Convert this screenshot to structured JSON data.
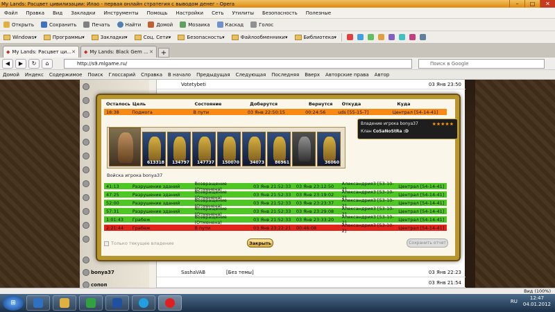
{
  "window": {
    "title": "My Lands: Расцвет цивилизации: Илао - первая онлайн стратегия с выводом денег - Opera"
  },
  "menu": [
    "Файл",
    "Правка",
    "Вид",
    "Закладки",
    "Инструменты",
    "Помощь",
    "Настройки",
    "Сеть",
    "Утилиты",
    "Безопасность",
    "Полезные"
  ],
  "toolbar1": [
    "Открыть",
    "Сохранить",
    "Печать",
    "Найти",
    "Домой",
    "Мозаика",
    "Каскад",
    "Голос"
  ],
  "toolbar2": [
    "Windows",
    "Программы",
    "Закладки",
    "Соц. Сети",
    "Безопасность",
    "Файлообменники",
    "Библиотека"
  ],
  "tabs": [
    {
      "label": "My Lands: Расцвет ци..."
    },
    {
      "label": "My Lands: Black Gem ..."
    }
  ],
  "address": {
    "url": "http://s9.mlgame.ru/",
    "search_placeholder": "Поиск в Google"
  },
  "navlinks": [
    "Домой",
    "Индекс",
    "Содержимое",
    "Поиск",
    "Глоссарий",
    "Справка",
    "В начало",
    "Предыдущая",
    "Следующая",
    "Последняя",
    "Вверх",
    "Авторские права",
    "Автор"
  ],
  "background": {
    "left_rows": [
      {
        "name": ""
      },
      {
        "name": ""
      },
      {
        "name": ""
      },
      {
        "name": ""
      },
      {
        "name": ""
      },
      {
        "name": ""
      },
      {
        "name": ""
      },
      {
        "name": ""
      },
      {
        "name": ""
      },
      {
        "name": ""
      },
      {
        "name": ""
      },
      {
        "name": ""
      },
      {
        "name": ""
      },
      {
        "name": "bonya37"
      },
      {
        "name": "сопоп"
      }
    ],
    "top_row": {
      "name": "Votetybeti",
      "date": "03 Янв 23:50"
    },
    "bottom_rows": [
      {
        "name": "SashaVAB",
        "note": "[Без темы]",
        "date": "03 Янв 22:23"
      },
      {
        "name": "",
        "note": "",
        "date": "03 Янв 21:54"
      }
    ]
  },
  "modal": {
    "headers": [
      "Осталось",
      "Цель",
      "Состояние",
      "Доберутся",
      "Вернутся",
      "Откуда",
      "Куда"
    ],
    "top_row": {
      "left": "18:38",
      "goal": "Подмога",
      "state": "В пути",
      "arrive": "03 Янв 22:50:15",
      "return": "00:24:56",
      "from": "uds [55-15-7]",
      "to": "Централ [54-14-41]"
    },
    "army": {
      "label": "Войска игрока bonya37",
      "counts": [
        "",
        "613318",
        "134797",
        "147737",
        "150070",
        "34073",
        "86961",
        "",
        "36060"
      ]
    },
    "tooltip": {
      "title": "Владение игрока bonya37",
      "clan_label": "Клан",
      "clan": "CoSaNoStRa :D",
      "stars": "★★★★★"
    },
    "rows": [
      {
        "left": "41:13",
        "goal": "Разрушение зданий",
        "state": "Возвращение (Отменена)",
        "arrive": "03 Янв 21:52:33",
        "return": "03 Янв 23:12:50",
        "from": "Александрия3 [53-10-2]",
        "to": "Централ [54-14-41]",
        "color": "green"
      },
      {
        "left": "47:25",
        "goal": "Разрушение зданий",
        "state": "Возвращение (Отменена)",
        "arrive": "03 Янв 21:52:33",
        "return": "03 Янв 23:19:02",
        "from": "Александрия3 [53-10-2]",
        "to": "Централ [54-14-41]",
        "color": "green"
      },
      {
        "left": "52:00",
        "goal": "Разрушение зданий",
        "state": "Возвращение (Отменена)",
        "arrive": "03 Янв 21:52:33",
        "return": "03 Янв 23:23:37",
        "from": "Александрия3 [53-10-2]",
        "to": "Централ [54-14-41]",
        "color": "green"
      },
      {
        "left": "57:31",
        "goal": "Разрушение зданий",
        "state": "Возвращение (Отменена)",
        "arrive": "03 Янв 21:52:33",
        "return": "03 Янв 23:29:08",
        "from": "Александрия3 [53-10-2]",
        "to": "Централ [54-14-41]",
        "color": "green"
      },
      {
        "left": "1:01:43",
        "goal": "Грабеж",
        "state": "Возвращение (Отменена)",
        "arrive": "03 Янв 21:52:33",
        "return": "03 Янв 23:33:20",
        "from": "Александрия3 [53-10-2]",
        "to": "Централ [54-14-41]",
        "color": "green"
      },
      {
        "left": "2:21:44",
        "goal": "Грабеж",
        "state": "В пути",
        "arrive": "03 Янв 23:22:21",
        "return": "00:46:08",
        "from": "Александрия3 [53-10-2]",
        "to": "Централ [54-14-41]",
        "color": "red"
      }
    ],
    "check_label": "Только текущее владение",
    "close_label": "Закрыть",
    "save_label": "Сохранить отчет"
  },
  "statusbar": {
    "zoom": "Вид (100%)"
  },
  "taskbar": {
    "lang": "RU",
    "time": "12:47",
    "date": "04.01.2012"
  }
}
